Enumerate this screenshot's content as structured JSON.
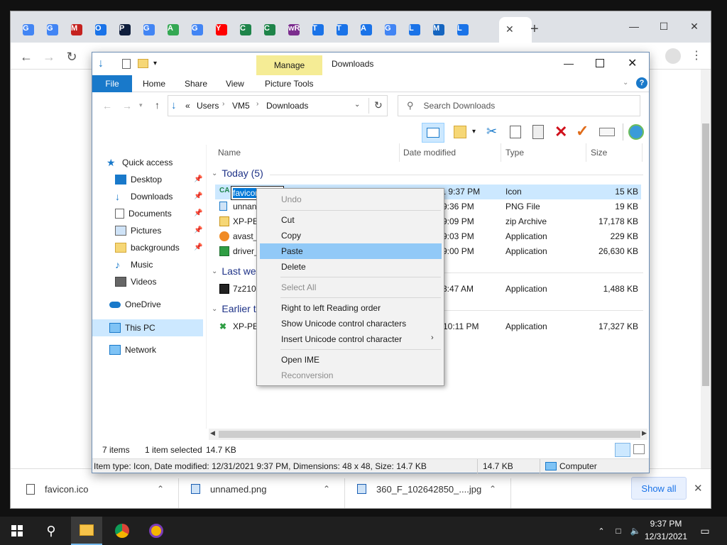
{
  "browser": {
    "tab_favicons": [
      "G",
      "G",
      "M",
      "O",
      "P",
      "G",
      "A",
      "G",
      "Y",
      "C",
      "C",
      "wR",
      "T",
      "T",
      "A",
      "G",
      "L",
      "M",
      "L"
    ],
    "close_tab": "✕",
    "new_tab": "+",
    "window_controls": {
      "minimize": "—",
      "maximize": "☐",
      "close": "✕"
    }
  },
  "downloads_bar": {
    "items": [
      {
        "name": "favicon.ico",
        "icon": "file-icon"
      },
      {
        "name": "unnamed.png",
        "icon": "image-file-icon"
      },
      {
        "name": "360_F_102642850_....jpg",
        "icon": "image-file-icon"
      }
    ],
    "show_all": "Show all",
    "close": "✕"
  },
  "explorer": {
    "title": "Downloads",
    "manage_tab": "Manage",
    "ribbon_tabs": [
      "File",
      "Home",
      "Share",
      "View",
      "Picture Tools"
    ],
    "address": {
      "prefix": "«",
      "crumbs": [
        "Users",
        "VM5",
        "Downloads"
      ]
    },
    "search_placeholder": "Search Downloads",
    "nav": {
      "quick_access": "Quick access",
      "items": [
        {
          "label": "Desktop",
          "pinned": true
        },
        {
          "label": "Downloads",
          "pinned": true
        },
        {
          "label": "Documents",
          "pinned": true
        },
        {
          "label": "Pictures",
          "pinned": true
        },
        {
          "label": "backgrounds",
          "pinned": true
        },
        {
          "label": "Music",
          "pinned": false
        },
        {
          "label": "Videos",
          "pinned": false
        }
      ],
      "onedrive": "OneDrive",
      "this_pc": "This PC",
      "network": "Network"
    },
    "columns": [
      "Name",
      "Date modified",
      "Type",
      "Size"
    ],
    "groups": {
      "today": "Today (5)",
      "last_week": "Last we",
      "earlier": "Earlier t"
    },
    "rows": [
      {
        "name": "favicon",
        "date": "12/31/2021 9:37 PM",
        "type": "Icon",
        "size": "15 KB",
        "selected": true
      },
      {
        "name": "unnan",
        "date": "9:36 PM",
        "type": "PNG File",
        "size": "19 KB"
      },
      {
        "name": "XP-PE",
        "date": "9:09 PM",
        "type": "zip Archive",
        "size": "17,178 KB"
      },
      {
        "name": "avast_",
        "date": "9:03 PM",
        "type": "Application",
        "size": "229 KB"
      },
      {
        "name": "driver_",
        "date": "9:00 PM",
        "type": "Application",
        "size": "26,630 KB"
      },
      {
        "name": "7z2106",
        "date": "3:47 AM",
        "type": "Application",
        "size": "1,488 KB"
      },
      {
        "name": "XP-PE",
        "date": "10:11 PM",
        "type": "Application",
        "size": "17,327 KB"
      }
    ],
    "rename_text": "favicon",
    "status": {
      "count": "7 items",
      "selected": "1 item selected",
      "size": "14.7 KB"
    },
    "details": {
      "text": "Item type: Icon, Date modified: 12/31/2021 9:37 PM, Dimensions: 48 x 48, Size: 14.7 KB",
      "size": "14.7 KB",
      "location": "Computer"
    }
  },
  "context_menu": {
    "undo": "Undo",
    "cut": "Cut",
    "copy": "Copy",
    "paste": "Paste",
    "delete": "Delete",
    "select_all": "Select All",
    "rtl": "Right to left Reading order",
    "show_unicode": "Show Unicode control characters",
    "insert_unicode": "Insert Unicode control character",
    "open_ime": "Open IME",
    "reconversion": "Reconversion"
  },
  "taskbar": {
    "time": "9:37 PM",
    "date": "12/31/2021"
  },
  "colors": {
    "accent": "#1979ca",
    "selection": "#cce8ff",
    "menu_highlight": "#91c9f7",
    "manage_tab": "#f5ec95"
  }
}
